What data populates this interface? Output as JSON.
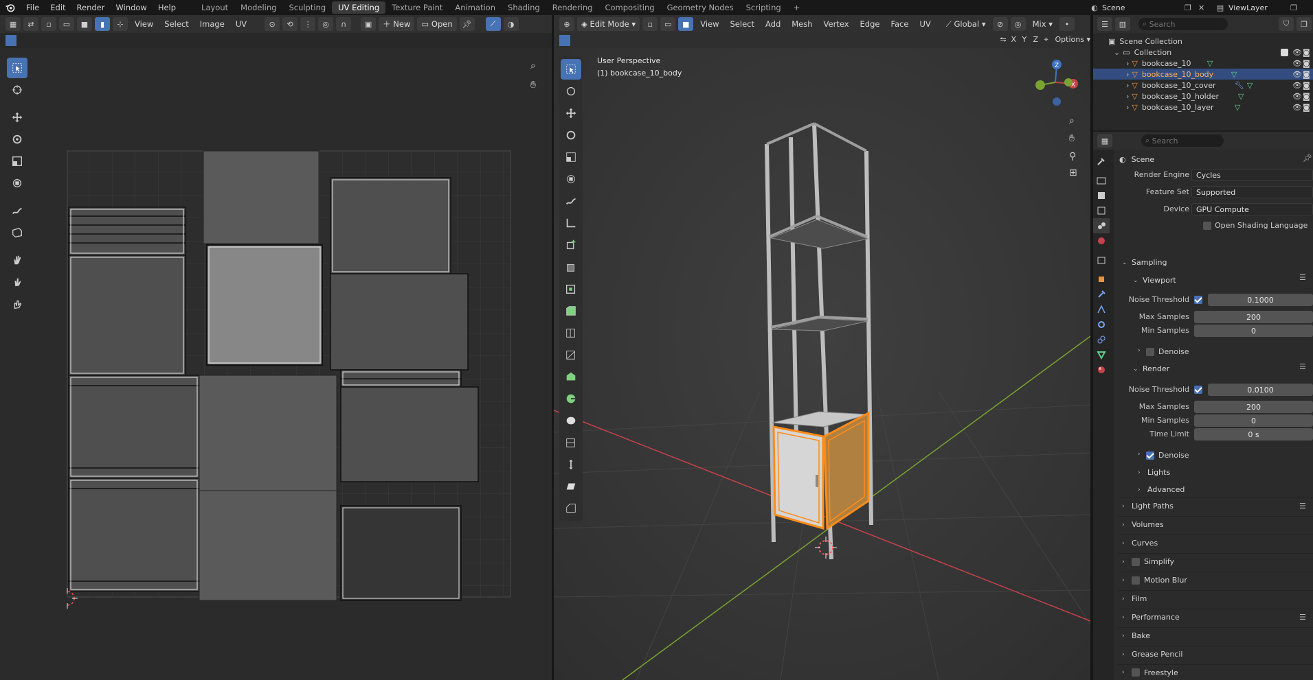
{
  "top_menu": [
    "File",
    "Edit",
    "Render",
    "Window",
    "Help"
  ],
  "workspaces": [
    {
      "label": "Layout",
      "active": false
    },
    {
      "label": "Modeling",
      "active": false
    },
    {
      "label": "Sculpting",
      "active": false
    },
    {
      "label": "UV Editing",
      "active": true
    },
    {
      "label": "Texture Paint",
      "active": false
    },
    {
      "label": "Animation",
      "active": false
    },
    {
      "label": "Shading",
      "active": false
    },
    {
      "label": "Rendering",
      "active": false
    },
    {
      "label": "Compositing",
      "active": false
    },
    {
      "label": "Geometry Nodes",
      "active": false
    },
    {
      "label": "Scripting",
      "active": false
    }
  ],
  "scene_name": "Scene",
  "view_layer": "ViewLayer",
  "uv_editor": {
    "menus": [
      "View",
      "Select",
      "Image",
      "UV"
    ],
    "new_label": "New",
    "open_label": "Open"
  },
  "viewport": {
    "mode": "Edit Mode",
    "menus": [
      "View",
      "Select",
      "Add",
      "Mesh",
      "Vertex",
      "Edge",
      "Face",
      "UV"
    ],
    "orientation": "Global",
    "shading": "Mix",
    "options_label": "Options",
    "axes": [
      "X",
      "Y",
      "Z"
    ],
    "overlay_title": "User Perspective",
    "overlay_object": "(1) bookcase_10_body"
  },
  "outliner": {
    "search_placeholder": "Search",
    "root": "Scene Collection",
    "collection": "Collection",
    "items": [
      {
        "name": "bookcase_10",
        "selected": false
      },
      {
        "name": "bookcase_10_body",
        "selected": true
      },
      {
        "name": "bookcase_10_cover",
        "selected": false
      },
      {
        "name": "bookcase_10_holder",
        "selected": false
      },
      {
        "name": "bookcase_10_layer",
        "selected": false
      }
    ]
  },
  "properties": {
    "search_placeholder": "Search",
    "context": "Scene",
    "render_engine_label": "Render Engine",
    "render_engine": "Cycles",
    "feature_set_label": "Feature Set",
    "feature_set": "Supported",
    "device_label": "Device",
    "device": "GPU Compute",
    "osl_label": "Open Shading Language",
    "sampling": "Sampling",
    "viewport": "Viewport",
    "noise_threshold_label": "Noise Threshold",
    "viewport_noise_threshold": "0.1000",
    "max_samples_label": "Max Samples",
    "viewport_max_samples": "200",
    "min_samples_label": "Min Samples",
    "viewport_min_samples": "0",
    "denoise_label": "Denoise",
    "render": "Render",
    "render_noise_threshold": "0.0100",
    "render_max_samples": "200",
    "render_min_samples": "0",
    "time_limit_label": "Time Limit",
    "time_limit": "0 s",
    "lights": "Lights",
    "advanced": "Advanced",
    "panels": [
      "Light Paths",
      "Volumes",
      "Curves",
      "Simplify",
      "Motion Blur",
      "Film",
      "Performance",
      "Bake",
      "Grease Pencil",
      "Freestyle"
    ]
  },
  "colors": {
    "accent": "#4772b3",
    "selection_orange": "#ff8c1a",
    "x_axis": "#c8414b",
    "y_axis": "#7aa331",
    "z_axis": "#3f74c4"
  }
}
